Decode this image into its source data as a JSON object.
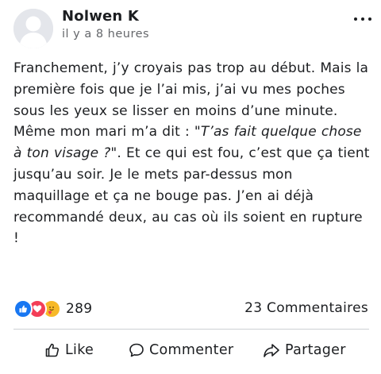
{
  "post": {
    "author": "Nolwen K",
    "timestamp": "il y a 8 heures",
    "text_part1": "Franchement, j’y croyais pas trop au début. Mais la première fois que je l’ai mis, j’ai vu mes poches sous les yeux se lisser en moins d’une minute. Même mon mari m’a dit : ",
    "text_quote": "\"T’as fait quelque chose à ton visage ?\"",
    "text_part2": ". Et ce qui est fou, c’est que ça tient jusqu’au soir. Je le mets par-dessus mon maquillage et ça ne bouge pas. J’en ai déjà recommandé deux, au cas où ils soient en rupture !"
  },
  "reactions": {
    "icons": [
      "like-icon",
      "love-icon",
      "care-icon"
    ],
    "count": "289"
  },
  "comments": {
    "label": "23 Commentaires"
  },
  "actions": {
    "like": "Like",
    "comment": "Commenter",
    "share": "Partager"
  },
  "colors": {
    "like_blue": "#1877f2",
    "love_red": "#f33e58",
    "care_yellow": "#f7b928",
    "secondary_text": "#65676b"
  }
}
